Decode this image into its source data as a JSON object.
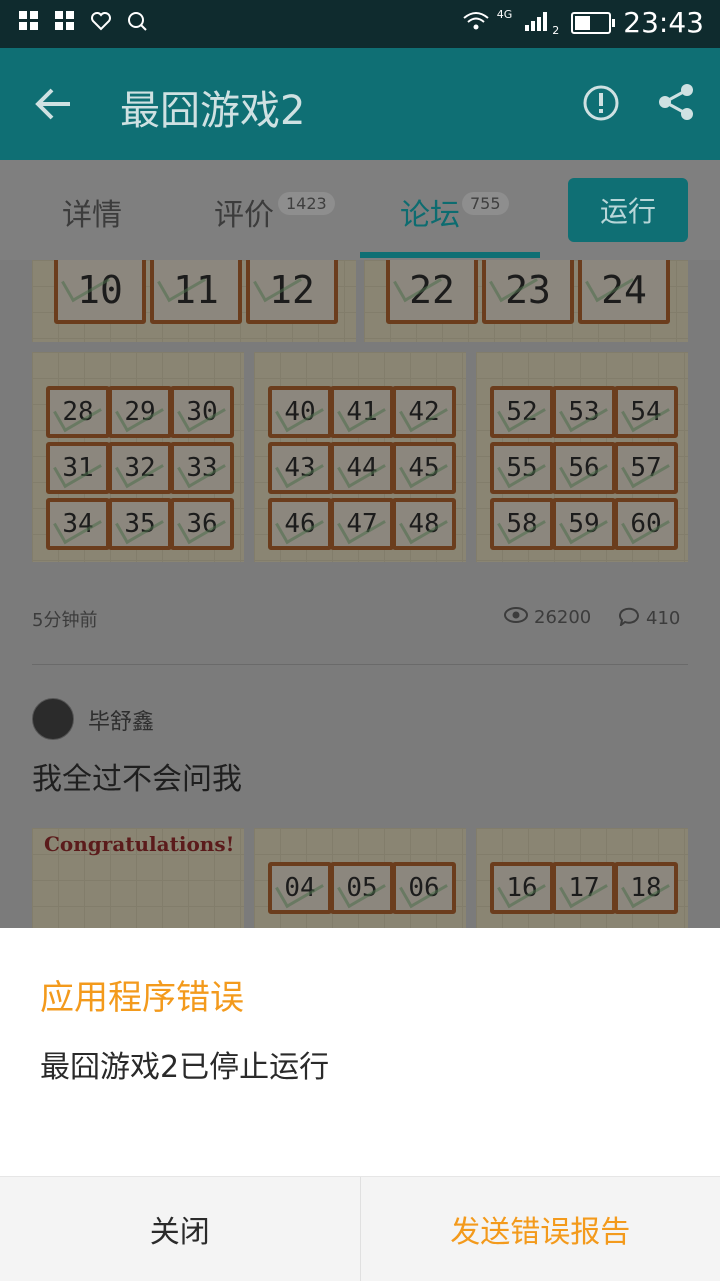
{
  "status_bar": {
    "time": "23:43",
    "network": "4G",
    "sim_index": "2"
  },
  "app_bar": {
    "title": "最囧游戏2"
  },
  "tabs": [
    {
      "label": "详情",
      "badge": ""
    },
    {
      "label": "评价",
      "badge": "1423"
    },
    {
      "label": "论坛",
      "badge": "755"
    }
  ],
  "run_button": "运行",
  "post1": {
    "time_ago": "5分钟前",
    "views": "26200",
    "comments": "410",
    "top_tiles": [
      "10",
      "11",
      "12",
      "22",
      "23",
      "24"
    ],
    "grid_tiles": [
      [
        "28",
        "29",
        "30",
        "31",
        "32",
        "33",
        "34",
        "35",
        "36"
      ],
      [
        "40",
        "41",
        "42",
        "43",
        "44",
        "45",
        "46",
        "47",
        "48"
      ],
      [
        "52",
        "53",
        "54",
        "55",
        "56",
        "57",
        "58",
        "59",
        "60"
      ]
    ]
  },
  "post2": {
    "username": "毕舒鑫",
    "text": "我全过不会问我",
    "congrats": "Congratulations!",
    "tiles_mid": [
      "04",
      "05",
      "06"
    ],
    "tiles_right": [
      "16",
      "17",
      "18"
    ]
  },
  "dialog": {
    "title": "应用程序错误",
    "message": "最囧游戏2已停止运行",
    "close_label": "关闭",
    "report_label": "发送错误报告"
  },
  "colors": {
    "accent": "#0f6f74",
    "dialog_accent": "#f39a1c"
  }
}
